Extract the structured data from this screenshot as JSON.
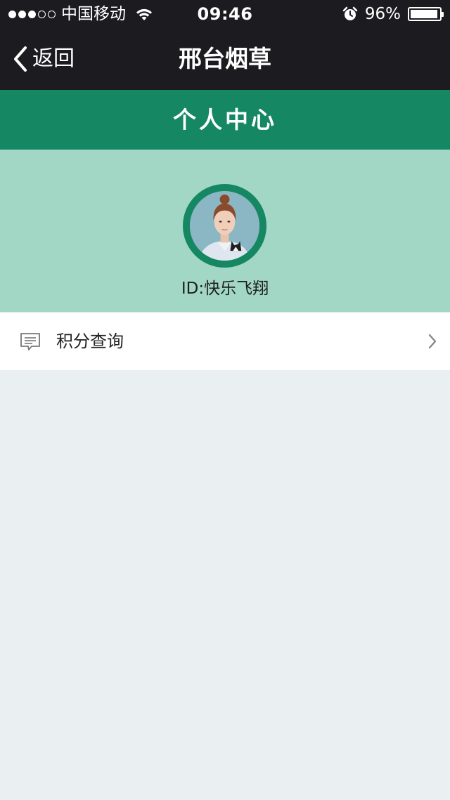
{
  "status_bar": {
    "carrier": "中国移动",
    "time": "09:46",
    "battery_percent_label": "96%",
    "battery_level": 0.96,
    "signal_bars_filled": 3,
    "signal_bars_total": 5,
    "icons": [
      "wifi-icon",
      "alarm-icon",
      "battery-icon"
    ]
  },
  "nav_bar": {
    "back_label": "返回",
    "title": "邢台烟草"
  },
  "section_header": {
    "title": "个人中心"
  },
  "profile": {
    "user_id_label": "ID:快乐飞翔"
  },
  "menu": {
    "items": [
      {
        "label": "积分查询",
        "icon": "message-icon"
      }
    ]
  },
  "colors": {
    "top_bar": "#1c1b20",
    "header_green": "#158762",
    "profile_bg": "#a2d7c5",
    "page_bg": "#eaeff2"
  }
}
